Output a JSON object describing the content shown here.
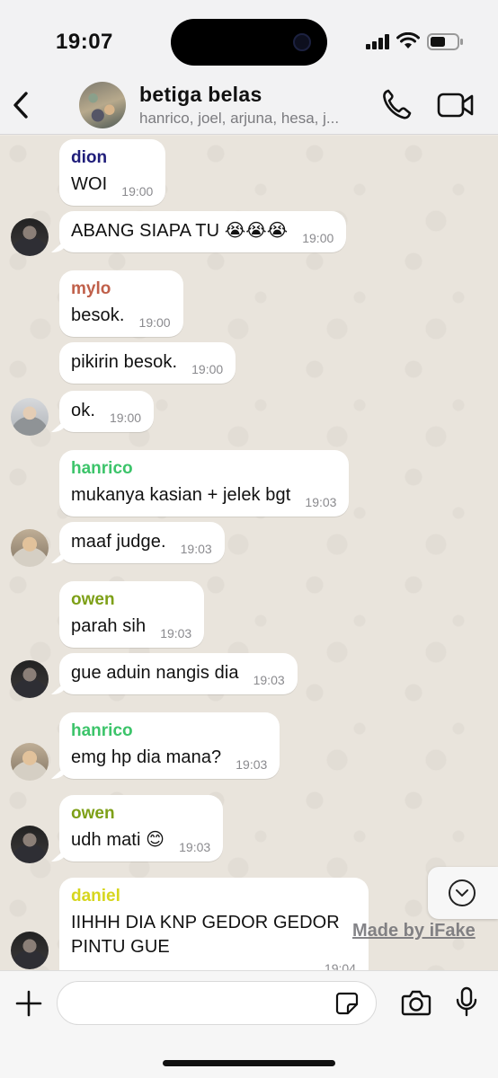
{
  "status_bar": {
    "time": "19:07"
  },
  "header": {
    "title": "betiga belas",
    "subtitle": "hanrico, joel, arjuna, hesa, j..."
  },
  "messages": [
    {
      "sender": "dion",
      "sender_color": "#1f1d7a",
      "text": "WOI",
      "time": "19:00"
    },
    {
      "text": "ABANG SIAPA TU 😭😭😭",
      "time": "19:00"
    },
    {
      "sender": "mylo",
      "sender_color": "#c0604a",
      "text": "besok.",
      "time": "19:00"
    },
    {
      "text": "pikirin besok.",
      "time": "19:00"
    },
    {
      "text": "ok.",
      "time": "19:00"
    },
    {
      "sender": "hanrico",
      "sender_color": "#3cc46a",
      "text": "mukanya kasian + jelek bgt",
      "time": "19:03"
    },
    {
      "text": "maaf judge.",
      "time": "19:03"
    },
    {
      "sender": "owen",
      "sender_color": "#7ea018",
      "text": "parah sih",
      "time": "19:03"
    },
    {
      "text": "gue aduin nangis dia",
      "time": "19:03"
    },
    {
      "sender": "hanrico",
      "sender_color": "#3cc46a",
      "text": "emg hp dia mana?",
      "time": "19:03"
    },
    {
      "sender": "owen",
      "sender_color": "#7ea018",
      "text": "udh mati 😊",
      "time": "19:03"
    },
    {
      "sender": "daniel",
      "sender_color": "#d6d61e",
      "text": "IIHHH DIA KNP GEDOR GEDOR PINTU GUE",
      "time": "19:04"
    }
  ],
  "watermark": "Made by iFake",
  "input": {
    "placeholder": ""
  }
}
